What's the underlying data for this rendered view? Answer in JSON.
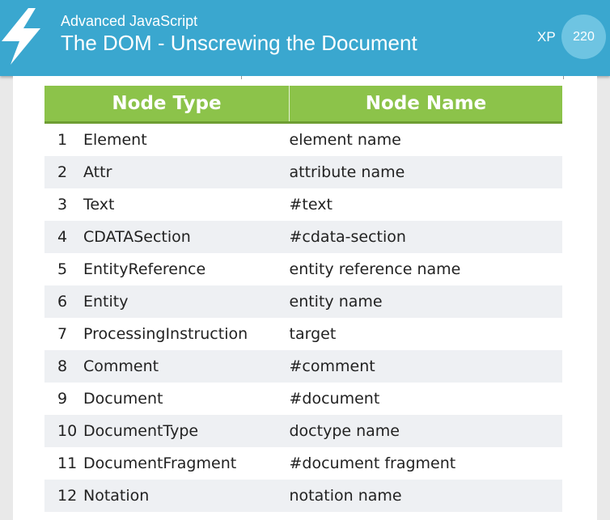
{
  "header": {
    "course": "Advanced JavaScript",
    "lesson": "The DOM - Unscrewing the Document",
    "xp_label": "XP",
    "xp_value": "220",
    "icon": "lightning-bolt-icon"
  },
  "colors": {
    "header": "#3aa7cf",
    "xp_circle": "#6ec4e2",
    "table_head": "#8cc34a",
    "row_alt": "#eef0f3"
  },
  "table": {
    "headers": [
      "Node Type",
      "Node Name"
    ],
    "rows": [
      {
        "num": "1",
        "type": "Element",
        "name": "element name"
      },
      {
        "num": "2",
        "type": "Attr",
        "name": "attribute name"
      },
      {
        "num": "3",
        "type": "Text",
        "name": "#text"
      },
      {
        "num": "4",
        "type": "CDATASection",
        "name": "#cdata-section"
      },
      {
        "num": "5",
        "type": "EntityReference",
        "name": "entity reference name"
      },
      {
        "num": "6",
        "type": "Entity",
        "name": "entity name"
      },
      {
        "num": "7",
        "type": "ProcessingInstruction",
        "name": "target"
      },
      {
        "num": "8",
        "type": "Comment",
        "name": "#comment"
      },
      {
        "num": "9",
        "type": "Document",
        "name": "#document"
      },
      {
        "num": "10",
        "type": "DocumentType",
        "name": "doctype name"
      },
      {
        "num": "11",
        "type": "DocumentFragment",
        "name": "#document fragment"
      },
      {
        "num": "12",
        "type": "Notation",
        "name": "notation name"
      }
    ]
  }
}
